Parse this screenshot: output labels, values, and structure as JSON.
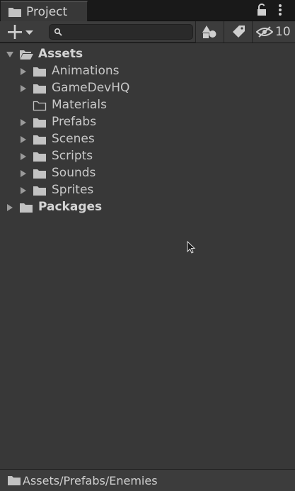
{
  "window": {
    "tab_title": "Project",
    "tab_icon": "folder-icon",
    "lock_icon": "lock-icon",
    "menu_icon": "kebab-menu-icon"
  },
  "toolbar": {
    "add_icon": "plus-dropdown-icon",
    "search": {
      "value": "",
      "placeholder": "",
      "icon": "search-icon"
    },
    "filter_by_type_icon": "shapes-icon",
    "filter_by_label_icon": "tag-icon",
    "hidden_packages_icon": "eye-slash-icon",
    "hidden_packages_count": "10"
  },
  "tree": {
    "items": [
      {
        "label": "Assets",
        "depth": 0,
        "expanded": true,
        "has_children": true,
        "bold": true,
        "folder": "open"
      },
      {
        "label": "Animations",
        "depth": 1,
        "expanded": false,
        "has_children": true,
        "bold": false,
        "folder": "closed"
      },
      {
        "label": "GameDevHQ",
        "depth": 1,
        "expanded": false,
        "has_children": true,
        "bold": false,
        "folder": "closed"
      },
      {
        "label": "Materials",
        "depth": 1,
        "expanded": false,
        "has_children": false,
        "bold": false,
        "folder": "empty"
      },
      {
        "label": "Prefabs",
        "depth": 1,
        "expanded": false,
        "has_children": true,
        "bold": false,
        "folder": "closed"
      },
      {
        "label": "Scenes",
        "depth": 1,
        "expanded": false,
        "has_children": true,
        "bold": false,
        "folder": "closed"
      },
      {
        "label": "Scripts",
        "depth": 1,
        "expanded": false,
        "has_children": true,
        "bold": false,
        "folder": "closed"
      },
      {
        "label": "Sounds",
        "depth": 1,
        "expanded": false,
        "has_children": true,
        "bold": false,
        "folder": "closed"
      },
      {
        "label": "Sprites",
        "depth": 1,
        "expanded": false,
        "has_children": true,
        "bold": false,
        "folder": "closed"
      },
      {
        "label": "Packages",
        "depth": 0,
        "expanded": false,
        "has_children": true,
        "bold": true,
        "folder": "closed"
      }
    ]
  },
  "status": {
    "path": "Assets/Prefabs/Enemies",
    "icon": "folder-icon"
  },
  "colors": {
    "background": "#383838",
    "toolbar": "#3c3c3c",
    "text": "#c8c8c8",
    "folder": "#c2c2c2"
  }
}
